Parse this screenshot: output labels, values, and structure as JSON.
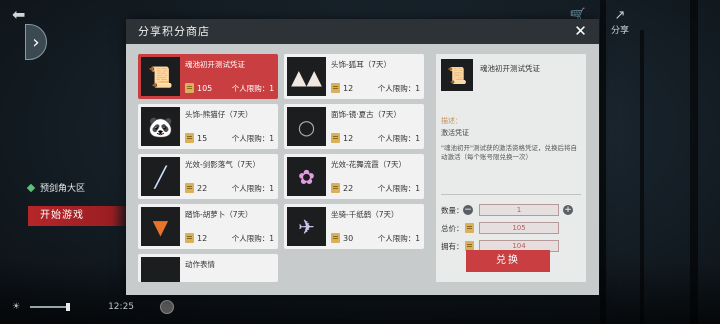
{
  "hud": {
    "back_icon": "back-arrow-icon",
    "side_tab_icon": "chevron-right-icon",
    "shop_icon": "cart-icon",
    "share_label": "分享",
    "server_name": "预剑角大区",
    "start_button": "开始游戏",
    "clock": "12:25"
  },
  "dialog": {
    "title": "分享积分商店",
    "close_icon": "close-icon",
    "items": [
      {
        "name": "魂池初开测试凭证",
        "price": "105",
        "limit": "个人限购：1",
        "icon": "scroll-icon",
        "selected": true
      },
      {
        "name": "头饰-狐耳（7天）",
        "price": "12",
        "limit": "个人限购：1",
        "icon": "fox-ears-icon"
      },
      {
        "name": "头饰-熊猫仔（7天）",
        "price": "15",
        "limit": "个人限购：1",
        "icon": "panda-icon"
      },
      {
        "name": "面饰-镜·夏古（7天）",
        "price": "12",
        "limit": "个人限购：1",
        "icon": "mirror-icon"
      },
      {
        "name": "光效-剑影落气（7天）",
        "price": "22",
        "limit": "个人限购：1",
        "icon": "sword-light-icon"
      },
      {
        "name": "光效-花舞流霞（7天）",
        "price": "22",
        "limit": "个人限购：1",
        "icon": "flower-light-icon"
      },
      {
        "name": "踏饰-胡萝卜（7天）",
        "price": "12",
        "limit": "个人限购：1",
        "icon": "carrot-icon"
      },
      {
        "name": "坐骑-千纸鹤（7天）",
        "price": "30",
        "limit": "个人限购：1",
        "icon": "paper-crane-icon"
      },
      {
        "name": "动作表情",
        "price": "",
        "limit": "",
        "icon": "emote-icon",
        "partial": true
      }
    ],
    "detail": {
      "title": "魂池初开测试凭证",
      "desc_label": "描述：",
      "desc_sub": "激活凭证",
      "desc_text": "\"魂池初开\"测试获的激活资格凭证，兑换后将自动激活（每个账号限兑换一次）",
      "qty_label": "数量：",
      "qty_value": "1",
      "total_label": "总价：",
      "total_value": "105",
      "own_label": "拥有：",
      "own_value": "104",
      "exchange_button": "兑换"
    }
  }
}
